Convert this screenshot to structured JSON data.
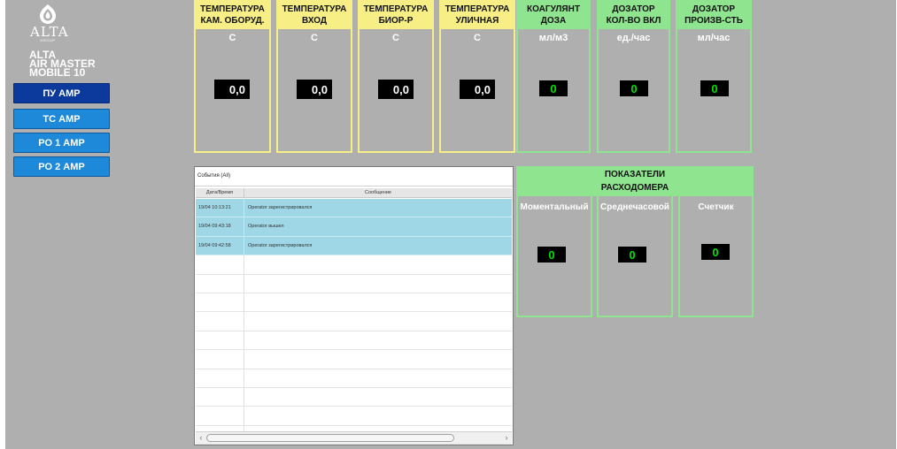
{
  "sidebar": {
    "brand": "ALTA",
    "brand_sub": "GROUP",
    "device_lines": [
      "ALTA",
      "AIR MASTER",
      "MOBILE 10"
    ],
    "buttons": [
      "ПУ АМР",
      "ТС АМР",
      "РО 1 АМР",
      "РО 2 АМР"
    ],
    "active_button": "ПУ АМР"
  },
  "tiles": [
    {
      "line1": "ТЕМПЕРАТУРА",
      "line2": "КАМ. ОБОРУД.",
      "unit": "С",
      "value": "0,0",
      "color": "#f7ef86"
    },
    {
      "line1": "ТЕМПЕРАТУРА",
      "line2": "ВХОД",
      "unit": "С",
      "value": "0,0",
      "color": "#f7ef86"
    },
    {
      "line1": "ТЕМПЕРАТУРА",
      "line2": "БИОР-Р",
      "unit": "С",
      "value": "0,0",
      "color": "#f7ef86"
    },
    {
      "line1": "ТЕМПЕРАТУРА",
      "line2": "УЛИЧНАЯ",
      "unit": "С",
      "value": "0,0",
      "color": "#f7ef86"
    },
    {
      "line1": "КОАГУЛЯНТ",
      "line2": "ДОЗА",
      "unit": "мл/м3",
      "value": "0",
      "color": "#8fe48f"
    },
    {
      "line1": "ДОЗАТОР",
      "line2": "КОЛ-ВО ВКЛ",
      "unit": "ед./час",
      "value": "0",
      "color": "#8fe48f"
    },
    {
      "line1": "ДОЗАТОР",
      "line2": "ПРОИЗВ-СТЬ",
      "unit": "мл/час",
      "value": "0",
      "color": "#8fe48f"
    }
  ],
  "events": {
    "title": "События (All)",
    "col_datetime": "Дата/Время",
    "col_message": "Сообщение",
    "rows": [
      {
        "time": "19/04 10:13:21",
        "message": "Operator зарегистрировался"
      },
      {
        "time": "19/04 09:43:18",
        "message": "Operator вышел"
      },
      {
        "time": "19/04 09:42:58",
        "message": "Operator зарегистрировался"
      }
    ],
    "empty_rows": 10,
    "scroll_left": "‹",
    "scroll_right": "›"
  },
  "flowmeter": {
    "title_line1": "ПОКАЗАТЕЛИ",
    "title_line2": "РАСХОДОМЕРА",
    "cells": [
      {
        "label": "Моментальный",
        "value": "0"
      },
      {
        "label": "Среднечасовой",
        "value": "0"
      },
      {
        "label": "Счетчик",
        "value": "0"
      }
    ]
  },
  "colors": {
    "background": "#afafaf",
    "button": "#1e88d9",
    "button_active": "#0b3a9c",
    "temp_header": "#f7ef86",
    "green_header": "#8fe48f",
    "value_green": "#00e000",
    "event_row": "#9fd7e6"
  }
}
